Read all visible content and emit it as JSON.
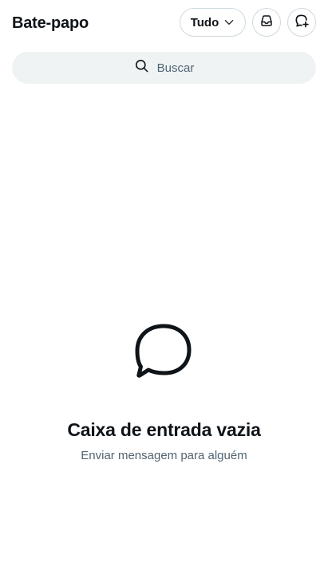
{
  "header": {
    "title": "Bate-papo",
    "filter": {
      "label": "Tudo",
      "icon": "chevron-down-icon"
    },
    "inbox_button_icon": "inbox-icon",
    "new_message_button_icon": "new-message-icon"
  },
  "search": {
    "placeholder": "Buscar",
    "icon": "search-icon"
  },
  "empty_state": {
    "icon": "chat-bubble-icon",
    "title": "Caixa de entrada vazia",
    "subtitle": "Enviar mensagem para alguém"
  },
  "colors": {
    "text_primary": "#0f1419",
    "text_secondary": "#536471",
    "border": "#cfd9de",
    "search_bg": "#eff3f4",
    "background": "#ffffff"
  }
}
